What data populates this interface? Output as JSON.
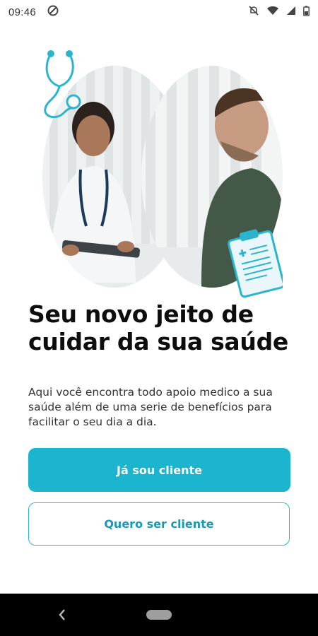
{
  "status_bar": {
    "time": "09:46",
    "left_icons": [
      "at-sign-icon"
    ],
    "right_icons": [
      "notifications-off-icon",
      "wifi-icon",
      "signal-icon",
      "battery-icon"
    ]
  },
  "hero": {
    "description_icons": [
      "stethoscope-icon",
      "clipboard-icon"
    ]
  },
  "headline": "Seu novo jeito de cuidar da sua saúde",
  "subtext": "Aqui você encontra todo apoio medico a sua saúde além de uma serie de benefícios para facilitar o seu dia a dia.",
  "buttons": {
    "primary_label": "Já sou cliente",
    "secondary_label": "Quero ser cliente"
  },
  "colors": {
    "accent": "#1cb5cf",
    "secondary_text": "#1b97b3",
    "nav_bar": "#000000"
  },
  "nav": {
    "icons": [
      "back-icon",
      "home-pill-icon"
    ]
  }
}
